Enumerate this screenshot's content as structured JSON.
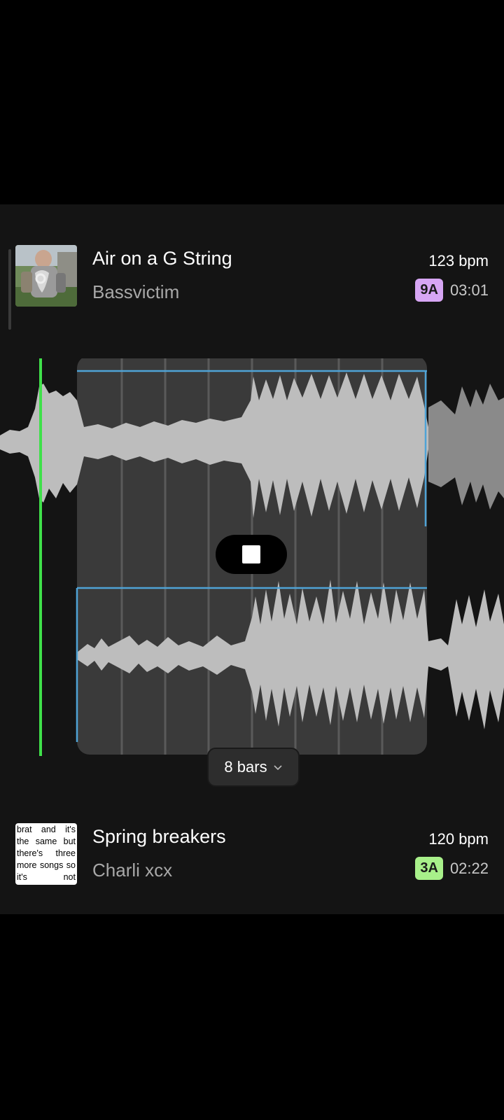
{
  "track_top": {
    "title": "Air on a G String",
    "artist": "Bassvictim",
    "bpm": "123 bpm",
    "key": "9A",
    "key_color": "#d7a6f4",
    "duration": "03:01",
    "art_icon": "album-photo"
  },
  "loop": {
    "length_label": "8 bars",
    "playhead_color": "#3fe04a",
    "selection_color": "#3a3a3a",
    "line_color": "#4fa3d6",
    "controls": {
      "stop_icon": "stop-icon",
      "chevron_icon": "chevron-down-icon"
    }
  },
  "track_bottom": {
    "title": "Spring breakers",
    "artist": "Charli xcx",
    "bpm": "120 bpm",
    "key": "3A",
    "key_color": "#a8f08a",
    "duration": "02:22",
    "art_text": "brat and it's the same but there's three more songs so it's not"
  }
}
